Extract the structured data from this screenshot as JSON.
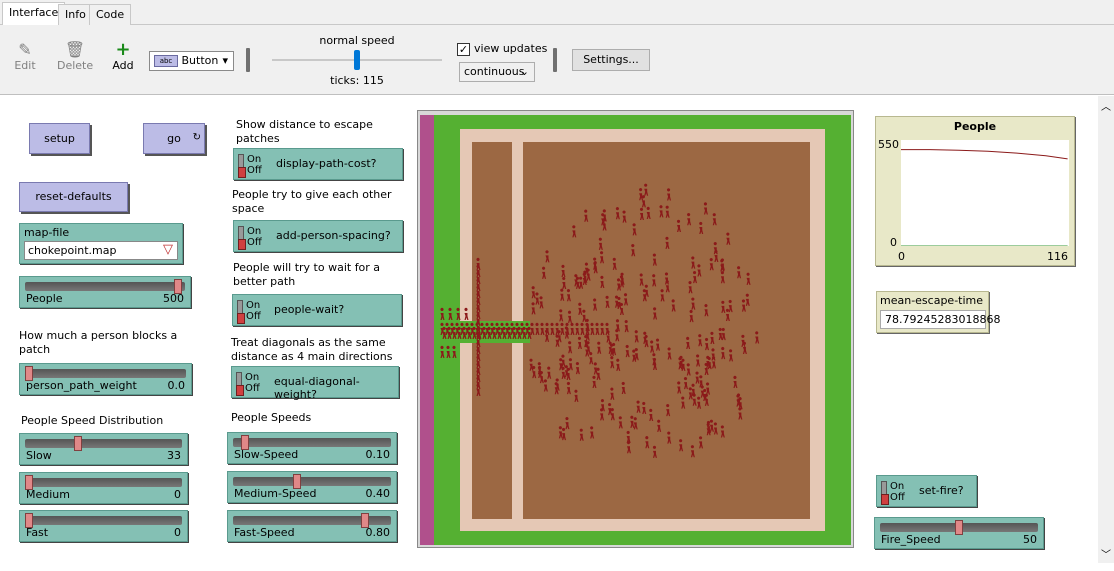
{
  "tabs": [
    "Interface",
    "Info",
    "Code"
  ],
  "toolbar": {
    "edit": "Edit",
    "delete": "Delete",
    "add": "Add",
    "widget_type": "Button",
    "speed_label": "normal speed",
    "ticks_label": "ticks: 115",
    "view_updates": "view updates",
    "view_updates_checked": true,
    "update_mode": "continuous",
    "settings": "Settings..."
  },
  "buttons": {
    "setup": "setup",
    "go": "go",
    "reset": "reset-defaults"
  },
  "chooser": {
    "label": "map-file",
    "value": "chokepoint.map"
  },
  "sliders": {
    "people": {
      "label": "People",
      "value": "500",
      "fraction": 0.98
    },
    "person_path_weight": {
      "label": "person_path_weight",
      "value": "0.0",
      "fraction": 0.0
    },
    "slow": {
      "label": "Slow",
      "value": "33",
      "fraction": 0.33
    },
    "medium": {
      "label": "Medium",
      "value": "0",
      "fraction": 0.0
    },
    "fast": {
      "label": "Fast",
      "value": "0",
      "fraction": 0.0
    },
    "slow_speed": {
      "label": "Slow-Speed",
      "value": "0.10",
      "fraction": 0.05
    },
    "medium_speed": {
      "label": "Medium-Speed",
      "value": "0.40",
      "fraction": 0.4
    },
    "fast_speed": {
      "label": "Fast-Speed",
      "value": "0.80",
      "fraction": 0.85
    },
    "fire_speed": {
      "label": "Fire_Speed",
      "value": "50",
      "fraction": 0.5
    }
  },
  "notes": {
    "person_block": "How much a person blocks a patch",
    "speed_dist": "People Speed Distribution",
    "show_distance": "Show distance to escape patches",
    "spacing": "People try to give each other space",
    "wait": "People will try to wait for a better path",
    "diagonals": "Treat diagonals as the same distance as 4 main directions",
    "people_speeds": "People Speeds"
  },
  "switches": {
    "on": "On",
    "off": "Off",
    "display_path_cost": "display-path-cost?",
    "add_person_spacing": "add-person-spacing?",
    "people_wait": "people-wait?",
    "equal_diagonal": "equal-diagonal-weight?",
    "set_fire": "set-fire?"
  },
  "plot": {
    "title": "People",
    "y_max": "550",
    "y_min": "0",
    "x_min": "0",
    "x_max": "116"
  },
  "chart_data": {
    "type": "line",
    "title": "People",
    "xlim": [
      0,
      116
    ],
    "ylim": [
      0,
      550
    ],
    "series": [
      {
        "values_x": [
          0,
          20,
          40,
          60,
          80,
          100,
          115
        ],
        "values_y": [
          500,
          500,
          497,
          492,
          482,
          468,
          452
        ],
        "color": "#8b1a1a"
      },
      {
        "values_x": [
          0,
          115
        ],
        "values_y": [
          0,
          0
        ],
        "color": "#3a9a3a"
      }
    ]
  },
  "monitor": {
    "label": "mean-escape-time",
    "value": "78.79245283018868"
  },
  "colors": {
    "wall": "#b0508c",
    "grass": "#55b032",
    "path": "#e5c8b5",
    "floor": "#9c6843",
    "person": "#8b1a1a"
  }
}
